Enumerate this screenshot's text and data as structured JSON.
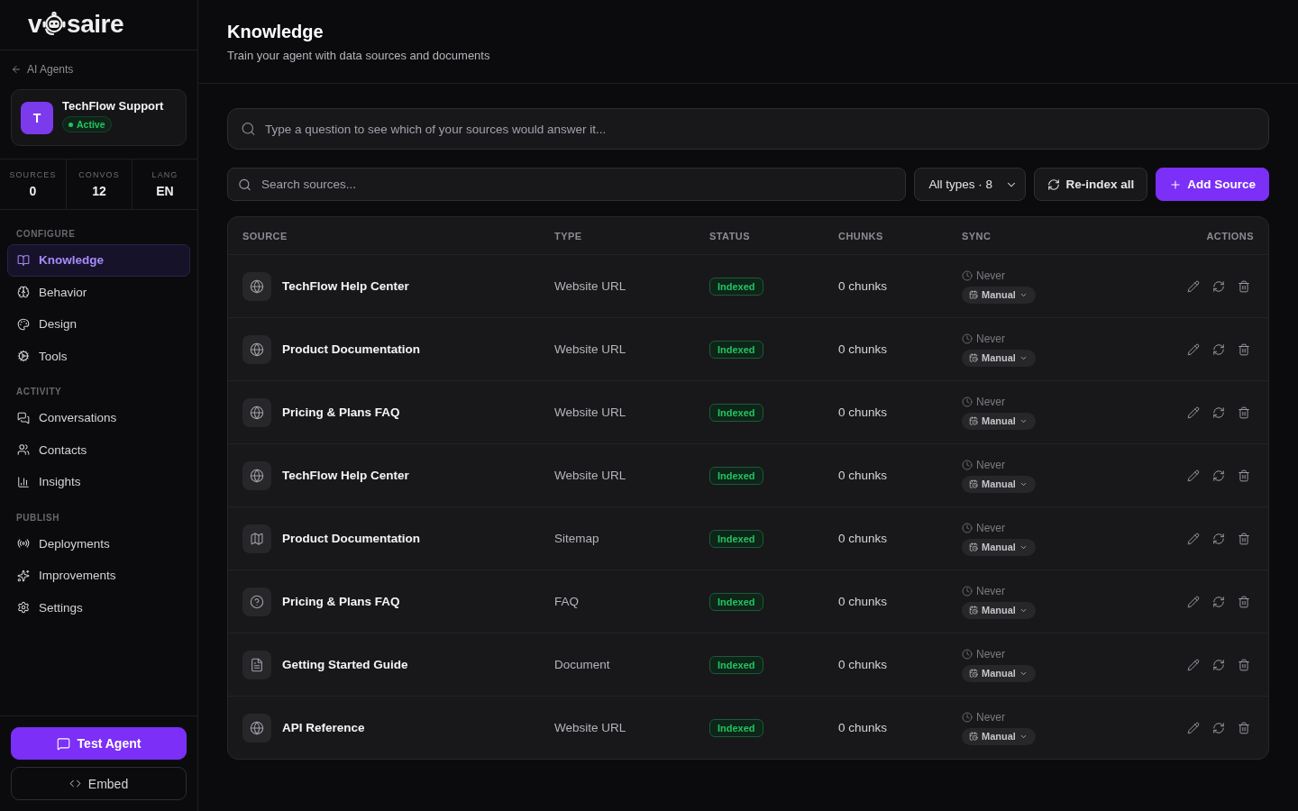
{
  "sidebar": {
    "logo": {
      "prefix": "v",
      "suffix": "saire"
    },
    "back_link": "AI Agents",
    "agent": {
      "initial": "T",
      "name": "TechFlow Support",
      "status": "Active"
    },
    "stats": [
      {
        "label": "SOURCES",
        "value": "0"
      },
      {
        "label": "CONVOS",
        "value": "12"
      },
      {
        "label": "LANG",
        "value": "EN"
      }
    ],
    "sections": [
      {
        "title": "CONFIGURE",
        "items": [
          {
            "label": "Knowledge",
            "selected": true
          },
          {
            "label": "Behavior",
            "selected": false
          },
          {
            "label": "Design",
            "selected": false
          },
          {
            "label": "Tools",
            "selected": false
          }
        ]
      },
      {
        "title": "ACTIVITY",
        "items": [
          {
            "label": "Conversations",
            "selected": false
          },
          {
            "label": "Contacts",
            "selected": false
          },
          {
            "label": "Insights",
            "selected": false
          }
        ]
      },
      {
        "title": "PUBLISH",
        "items": [
          {
            "label": "Deployments",
            "selected": false
          },
          {
            "label": "Improvements",
            "selected": false
          },
          {
            "label": "Settings",
            "selected": false
          }
        ]
      }
    ],
    "actions": [
      {
        "kind": "primary",
        "label": "Test Agent"
      },
      {
        "kind": "secondary",
        "label": "Embed"
      }
    ]
  },
  "header": {
    "title": "Knowledge",
    "subtitle": "Train your agent with data sources and documents"
  },
  "ask": {
    "placeholder": "Type a question to see which of your sources would answer it..."
  },
  "toolbar": {
    "search": {
      "placeholder": "Search sources..."
    },
    "type_filter": "All types · 8",
    "buttons": [
      {
        "kind": "secondary",
        "label": "Re-index all"
      },
      {
        "kind": "primary",
        "label": "Add Source"
      }
    ]
  },
  "table": {
    "columns": [
      "SOURCE",
      "TYPE",
      "STATUS",
      "CHUNKS",
      "SYNC",
      "ACTIONS"
    ],
    "rows": [
      {
        "kind": "url",
        "name": "TechFlow Help Center",
        "type": "Website URL",
        "status": "Indexed",
        "chunks": "0 chunks",
        "last_sync": "Never",
        "sync_mode": "Manual"
      },
      {
        "kind": "url",
        "name": "Product Documentation",
        "type": "Website URL",
        "status": "Indexed",
        "chunks": "0 chunks",
        "last_sync": "Never",
        "sync_mode": "Manual"
      },
      {
        "kind": "url",
        "name": "Pricing & Plans FAQ",
        "type": "Website URL",
        "status": "Indexed",
        "chunks": "0 chunks",
        "last_sync": "Never",
        "sync_mode": "Manual"
      },
      {
        "kind": "url",
        "name": "TechFlow Help Center",
        "type": "Website URL",
        "status": "Indexed",
        "chunks": "0 chunks",
        "last_sync": "Never",
        "sync_mode": "Manual"
      },
      {
        "kind": "sitemap",
        "name": "Product Documentation",
        "type": "Sitemap",
        "status": "Indexed",
        "chunks": "0 chunks",
        "last_sync": "Never",
        "sync_mode": "Manual"
      },
      {
        "kind": "faq",
        "name": "Pricing & Plans FAQ",
        "type": "FAQ",
        "status": "Indexed",
        "chunks": "0 chunks",
        "last_sync": "Never",
        "sync_mode": "Manual"
      },
      {
        "kind": "document",
        "name": "Getting Started Guide",
        "type": "Document",
        "status": "Indexed",
        "chunks": "0 chunks",
        "last_sync": "Never",
        "sync_mode": "Manual"
      },
      {
        "kind": "url",
        "name": "API Reference",
        "type": "Website URL",
        "status": "Indexed",
        "chunks": "0 chunks",
        "last_sync": "Never",
        "sync_mode": "Manual"
      }
    ]
  }
}
